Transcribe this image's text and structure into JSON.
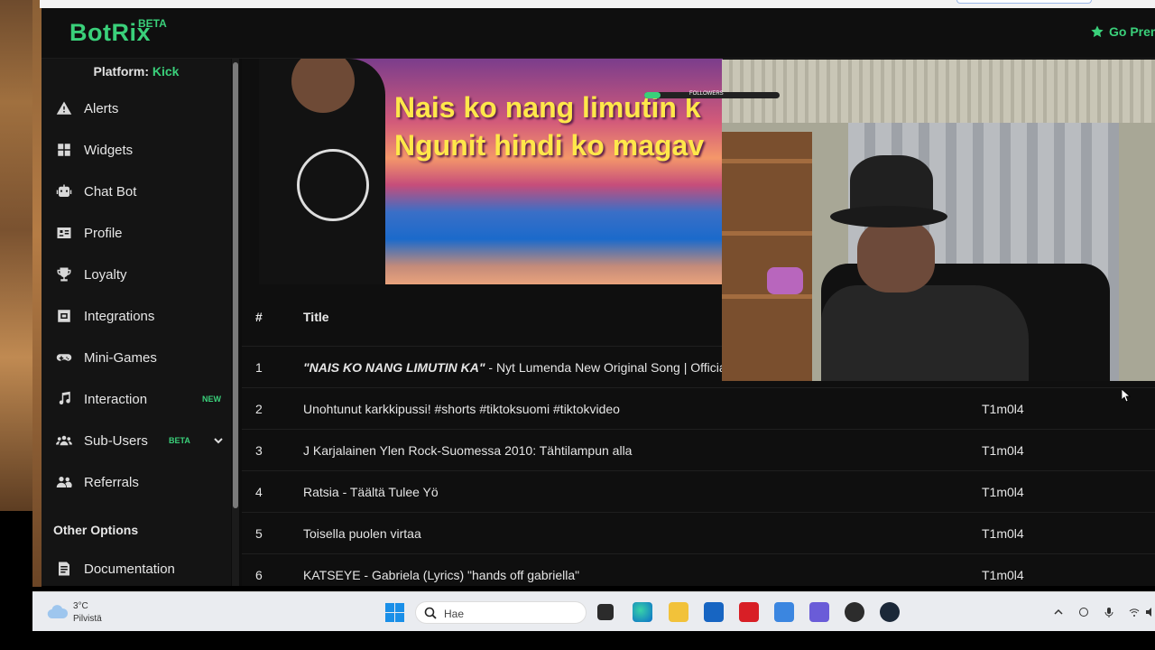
{
  "app": {
    "logo": "BotRix",
    "logo_badge": "BETA",
    "go_premium": "Go Prem"
  },
  "sidebar": {
    "platform_label": "Platform:",
    "platform_value": "Kick",
    "items": [
      {
        "label": "Alerts",
        "icon": "warning-icon"
      },
      {
        "label": "Widgets",
        "icon": "grid-icon"
      },
      {
        "label": "Chat Bot",
        "icon": "robot-icon"
      },
      {
        "label": "Profile",
        "icon": "id-card-icon"
      },
      {
        "label": "Loyalty",
        "icon": "trophy-icon"
      },
      {
        "label": "Integrations",
        "icon": "integration-icon"
      },
      {
        "label": "Mini-Games",
        "icon": "gamepad-icon"
      },
      {
        "label": "Interaction",
        "icon": "music-icon",
        "badge": "NEW"
      },
      {
        "label": "Sub-Users",
        "icon": "users-icon",
        "badge": "BETA"
      },
      {
        "label": "Referrals",
        "icon": "user-friends-icon"
      }
    ],
    "other_options": "Other Options",
    "documentation": "Documentation"
  },
  "video": {
    "lyric_line_1": "Nais ko nang limutin k",
    "lyric_line_2": "Ngunit hindi ko magav"
  },
  "overlay": {
    "followers_label": "FOLLOWERS"
  },
  "table": {
    "headers": {
      "num": "#",
      "title": "Title"
    },
    "rows": [
      {
        "num": "1",
        "title_em": "\"NAIS KO NANG LIMUTIN KA\"",
        "title": " - Nyt Lumenda New Original Song | Official",
        "user": ""
      },
      {
        "num": "2",
        "title_em": "",
        "title": "Unohtunut karkkipussi! #shorts #tiktoksuomi #tiktokvideo",
        "user": "T1m0l4"
      },
      {
        "num": "3",
        "title_em": "",
        "title": "J Karjalainen Ylen Rock-Suomessa 2010: Tähtilampun alla",
        "user": "T1m0l4"
      },
      {
        "num": "4",
        "title_em": "",
        "title": "Ratsia - Täältä Tulee Yö",
        "user": "T1m0l4"
      },
      {
        "num": "5",
        "title_em": "",
        "title": "Toisella puolen virtaa",
        "user": "T1m0l4"
      },
      {
        "num": "6",
        "title_em": "",
        "title": "KATSEYE - Gabriela (Lyrics) \"hands off gabriella\"",
        "user": "T1m0l4"
      }
    ]
  },
  "taskbar": {
    "weather_temp": "3°C",
    "weather_desc": "Pilvistä",
    "search_placeholder": "Hae"
  },
  "colors": {
    "accent": "#3ad07a",
    "background": "#0d0d0d",
    "sidebar": "#141414"
  }
}
